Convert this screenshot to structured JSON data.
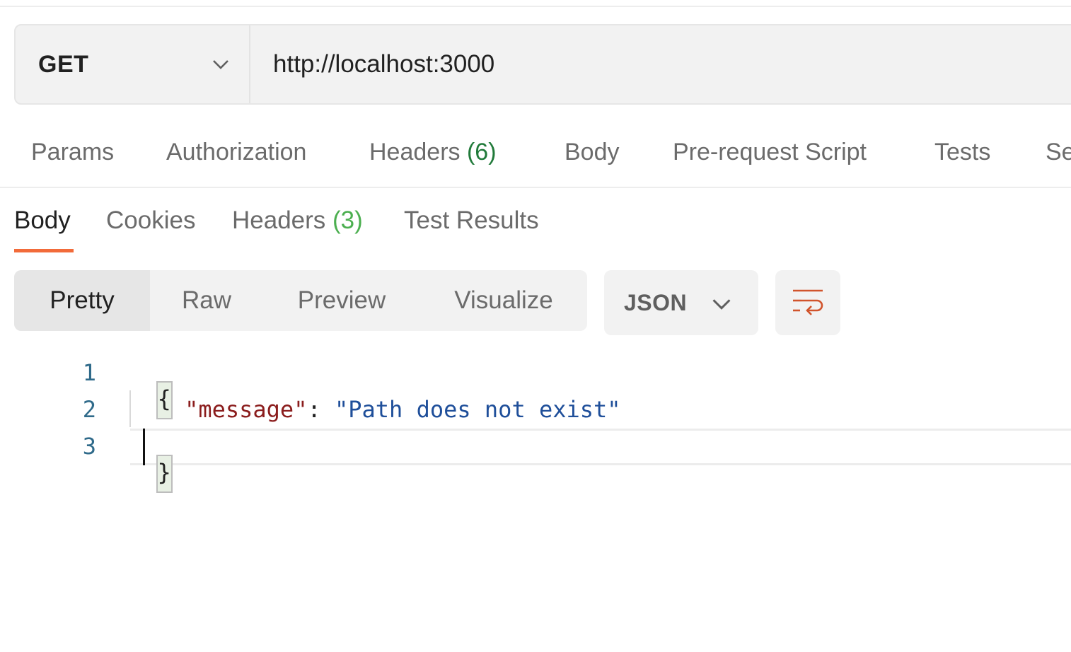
{
  "request": {
    "method": "GET",
    "url": "http://localhost:3000"
  },
  "request_tabs": [
    {
      "label": "Params"
    },
    {
      "label": "Authorization"
    },
    {
      "label": "Headers",
      "count": "(6)"
    },
    {
      "label": "Body"
    },
    {
      "label": "Pre-request Script"
    },
    {
      "label": "Tests"
    },
    {
      "label": "Se"
    }
  ],
  "response_tabs": [
    {
      "label": "Body",
      "active": true
    },
    {
      "label": "Cookies"
    },
    {
      "label": "Headers",
      "count": "(3)"
    },
    {
      "label": "Test Results"
    }
  ],
  "view_modes": [
    {
      "label": "Pretty",
      "active": true
    },
    {
      "label": "Raw"
    },
    {
      "label": "Preview"
    },
    {
      "label": "Visualize"
    }
  ],
  "format": {
    "selected": "JSON"
  },
  "icons": {
    "method_dropdown": "chevron-down-icon",
    "format_dropdown": "chevron-down-icon",
    "wrap": "wrap-lines-icon"
  },
  "colors": {
    "accent": "#f26b3a",
    "count_request": "#217a3a",
    "count_response": "#4caf50",
    "json_key": "#8b1d1d",
    "json_string": "#1f4f9a",
    "line_number": "#2f6a8a"
  },
  "editor": {
    "lines": [
      {
        "number": "1",
        "open_brace": "{"
      },
      {
        "number": "2",
        "indent": "    ",
        "key": "\"message\"",
        "colon": ": ",
        "value": "\"Path does not exist\""
      },
      {
        "number": "3",
        "close_brace": "}"
      }
    ]
  }
}
